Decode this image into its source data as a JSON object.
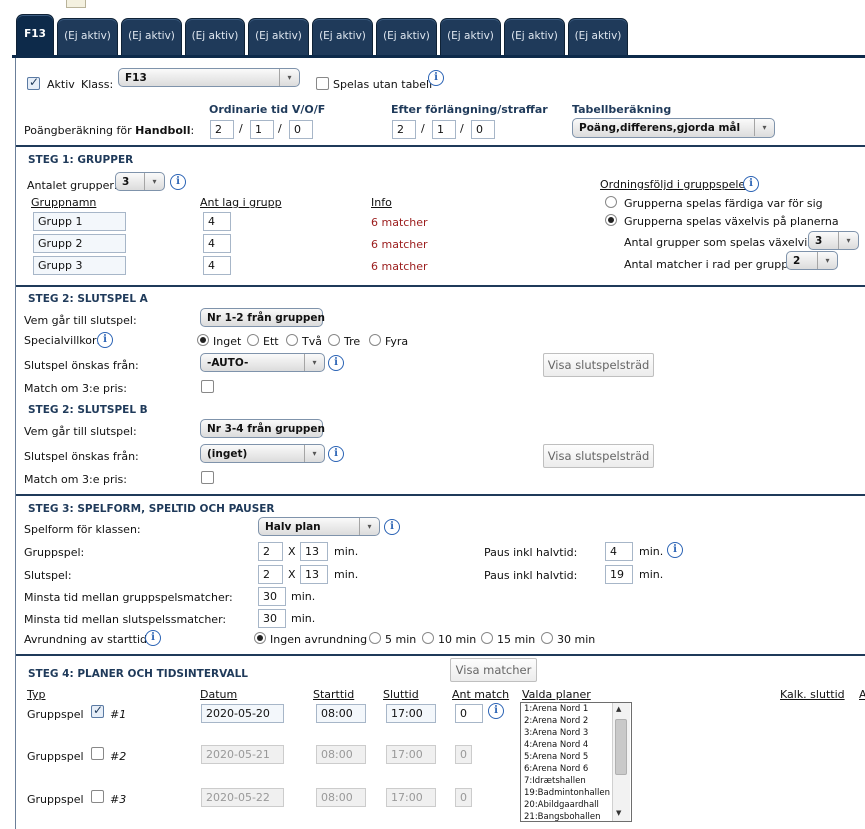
{
  "tabs": [
    {
      "label": "F13",
      "active": true
    },
    {
      "label": "(Ej aktiv)"
    },
    {
      "label": "(Ej aktiv)"
    },
    {
      "label": "(Ej aktiv)"
    },
    {
      "label": "(Ej aktiv)"
    },
    {
      "label": "(Ej aktiv)"
    },
    {
      "label": "(Ej aktiv)"
    },
    {
      "label": "(Ej aktiv)"
    },
    {
      "label": "(Ej aktiv)"
    },
    {
      "label": "(Ej aktiv)"
    }
  ],
  "top": {
    "aktiv_label": "Aktiv",
    "klass_label": "Klass:",
    "klass_value": "F13",
    "utan_tabell_label": "Spelas utan tabell",
    "ordinarie_header": "Ordinarie tid V/O/F",
    "forlangning_header": "Efter förlängning/straffar",
    "tabell_header": "Tabellberäkning",
    "poang_label": "Poängberäkning för",
    "sport": "Handboll",
    "ord": [
      "2",
      "1",
      "0"
    ],
    "eft": [
      "2",
      "1",
      "0"
    ],
    "slash": "/",
    "tabell_value": "Poäng,differens,gjorda mål"
  },
  "steg1": {
    "title": "STEG 1: GRUPPER",
    "antal_label": "Antalet grupper:",
    "antal_value": "3",
    "col_namn": "Gruppnamn",
    "col_antal": "Ant lag i grupp",
    "col_info": "Info",
    "groups": [
      {
        "name": "Grupp 1",
        "count": "4",
        "info": "6 matcher"
      },
      {
        "name": "Grupp 2",
        "count": "4",
        "info": "6 matcher"
      },
      {
        "name": "Grupp 3",
        "count": "4",
        "info": "6 matcher"
      }
    ],
    "order_label": "Ordningsföljd i gruppspelet",
    "opt_fardiga": "Grupperna spelas färdiga var för sig",
    "opt_vaxelvis": "Grupperna spelas växelvis på planerna",
    "antal_vaxelvis_label": "Antal grupper som spelas växelvis:",
    "antal_vaxelvis_value": "3",
    "matcher_i_rad_label": "Antal matcher i rad per grupp:",
    "matcher_i_rad_value": "2"
  },
  "steg2a": {
    "title": "STEG 2: SLUTSPEL A",
    "vem_label": "Vem går till slutspel:",
    "vem_value": "Nr 1-2 från gruppen",
    "special_label": "Specialvillkor:",
    "special_opts": [
      "Inget",
      "Ett",
      "Två",
      "Tre",
      "Fyra"
    ],
    "fran_label": "Slutspel önskas från:",
    "fran_value": "-AUTO-",
    "visa_btn": "Visa slutspelsträd",
    "match3_label": "Match om 3:e pris:"
  },
  "steg2b": {
    "title": "STEG 2: SLUTSPEL B",
    "vem_label": "Vem går till slutspel:",
    "vem_value": "Nr 3-4 från gruppen",
    "fran_label": "Slutspel önskas från:",
    "fran_value": "(inget)",
    "visa_btn": "Visa slutspelsträd",
    "match3_label": "Match om 3:e pris:"
  },
  "steg3": {
    "title": "STEG 3: SPELFORM, SPELTID OCH PAUSER",
    "spelform_label": "Spelform för klassen:",
    "spelform_value": "Halv plan",
    "gruppspel_label": "Gruppspel:",
    "gruppspel_a": "2",
    "gruppspel_b": "13",
    "slutspel_label": "Slutspel:",
    "slutspel_a": "2",
    "slutspel_b": "13",
    "x": "X",
    "min": "min.",
    "paus_label": "Paus inkl halvtid:",
    "paus1": "4",
    "paus2": "19",
    "minsta_grupp_label": "Minsta tid mellan gruppspelsmatcher:",
    "minsta_grupp": "30",
    "minsta_slut_label": "Minsta tid mellan slutspelssmatcher:",
    "minsta_slut": "30",
    "avrund_label": "Avrundning av starttid:",
    "avrund_opts": [
      "Ingen avrundning",
      "5 min",
      "10 min",
      "15 min",
      "30 min"
    ]
  },
  "steg4": {
    "title": "STEG 4: PLANER OCH TIDSINTERVALL",
    "visa_matcher": "Visa matcher",
    "col_typ": "Typ",
    "col_datum": "Datum",
    "col_start": "Starttid",
    "col_slut": "Sluttid",
    "col_ant": "Ant match",
    "col_planer": "Valda planer",
    "col_kalk": "Kalk. sluttid",
    "col_extra": "A",
    "rows": [
      {
        "typ": "Gruppspel",
        "nr": "#1",
        "datum": "2020-05-20",
        "start": "08:00",
        "slut": "17:00",
        "ant": "0"
      },
      {
        "typ": "Gruppspel",
        "nr": "#2",
        "datum": "2020-05-21",
        "start": "08:00",
        "slut": "17:00",
        "ant": "0"
      },
      {
        "typ": "Gruppspel",
        "nr": "#3",
        "datum": "2020-05-22",
        "start": "08:00",
        "slut": "17:00",
        "ant": "0"
      }
    ],
    "planer": [
      "1:Arena Nord 1",
      "2:Arena Nord 2",
      "3:Arena Nord 3",
      "4:Arena Nord 4",
      "5:Arena Nord 5",
      "6:Arena Nord 6",
      "7:Idrætshallen",
      "19:Badmintonhallen",
      "20:Abildgaardhall",
      "21:Bangsbohallen"
    ]
  },
  "icons": {
    "info": "i",
    "arrow": "▾",
    "scroll_up": "▲",
    "scroll_down": "▼"
  }
}
